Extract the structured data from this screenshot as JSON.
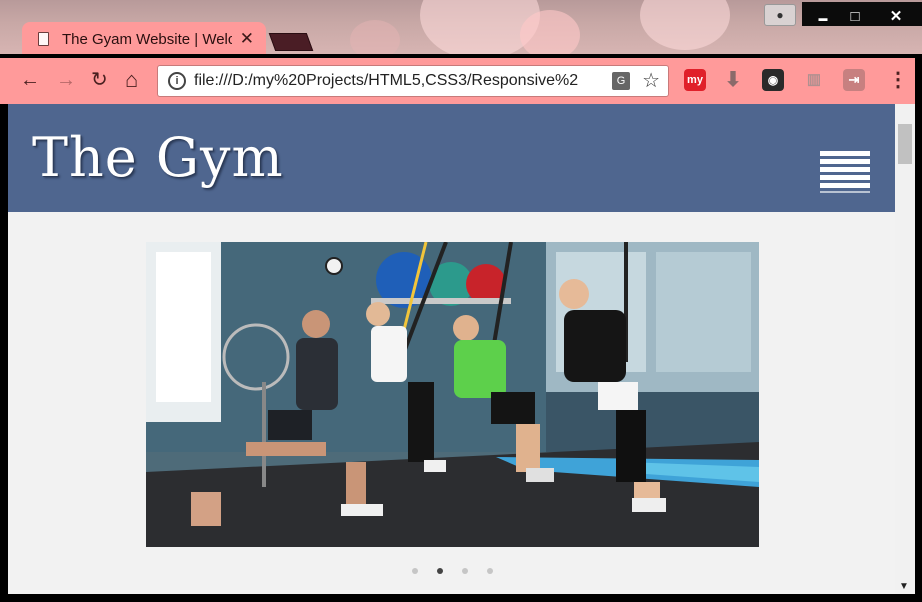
{
  "browser": {
    "tab_title": "The Gyam Website | Welc",
    "tab_close": "✕",
    "url": "file:///D:/my%20Projects/HTML5,CSS3/Responsive%2",
    "info_icon": "i",
    "translate_icon": "G",
    "star_icon": "☆",
    "back_icon": "←",
    "forward_icon": "→",
    "reload_icon": "↻",
    "home_icon": "⌂",
    "menu_icon": "⋮",
    "minimize_icon": "▬",
    "maximize_icon": "□",
    "close_icon": "✕",
    "user_icon": "👤",
    "ext_my_label": "my",
    "colors": {
      "theme": "#ff9a9a",
      "tab_text": "#2a0f0f"
    }
  },
  "site": {
    "logo_text": "The Gym",
    "header_color": "#4f668f",
    "background_color": "#f2f2f2"
  },
  "slider": {
    "image_description_icon": "gym-trx-training-photo",
    "dot_count": 4,
    "active_dot": 2
  }
}
